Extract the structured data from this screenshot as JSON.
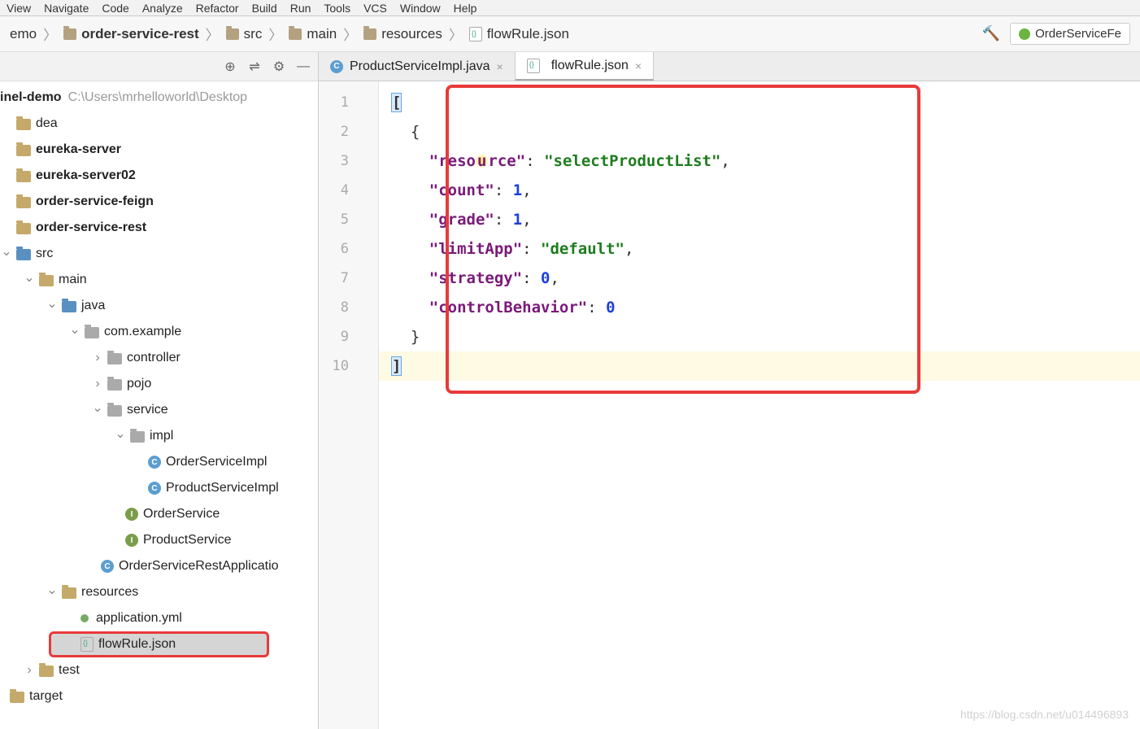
{
  "menu": {
    "items": [
      "View",
      "Navigate",
      "Code",
      "Analyze",
      "Refactor",
      "Build",
      "Run",
      "Tools",
      "VCS",
      "Window",
      "Help"
    ]
  },
  "breadcrumb": {
    "items": [
      {
        "label": "emo"
      },
      {
        "label": "order-service-rest",
        "bold": true
      },
      {
        "label": "src"
      },
      {
        "label": "main"
      },
      {
        "label": "resources"
      },
      {
        "label": "flowRule.json",
        "icon": "json"
      }
    ],
    "runConfig": "OrderServiceFe"
  },
  "projectTree": {
    "root": {
      "label": "inel-demo",
      "path": "C:\\Users\\mrhelloworld\\Desktop"
    },
    "nodes": [
      {
        "label": "dea",
        "icon": "folder",
        "indent": 0
      },
      {
        "label": "eureka-server",
        "icon": "folder",
        "bold": true,
        "indent": 0
      },
      {
        "label": "eureka-server02",
        "icon": "folder",
        "bold": true,
        "indent": 0
      },
      {
        "label": "order-service-feign",
        "icon": "folder",
        "bold": true,
        "indent": 0
      },
      {
        "label": "order-service-rest",
        "icon": "folder",
        "bold": true,
        "indent": 0
      },
      {
        "label": "src",
        "icon": "folder-blue",
        "indent": 1,
        "chevron": "down"
      },
      {
        "label": "main",
        "icon": "folder",
        "indent": 2,
        "chevron": "down"
      },
      {
        "label": "java",
        "icon": "folder-blue",
        "indent": 3,
        "chevron": "down"
      },
      {
        "label": "com.example",
        "icon": "folder-gray",
        "indent": 4,
        "chevron": "down"
      },
      {
        "label": "controller",
        "icon": "folder-gray",
        "indent": 5,
        "chevron": "right"
      },
      {
        "label": "pojo",
        "icon": "folder-gray",
        "indent": 5,
        "chevron": "right"
      },
      {
        "label": "service",
        "icon": "folder-gray",
        "indent": 5,
        "chevron": "down"
      },
      {
        "label": "impl",
        "icon": "folder-gray",
        "indent": 6,
        "chevron": "down"
      },
      {
        "label": "OrderServiceImpl",
        "icon": "class",
        "indent": 7
      },
      {
        "label": "ProductServiceImpl",
        "icon": "class",
        "indent": 7
      },
      {
        "label": "OrderService",
        "icon": "interface",
        "indent": 6
      },
      {
        "label": "ProductService",
        "icon": "interface",
        "indent": 6
      },
      {
        "label": "OrderServiceRestApplicatio",
        "icon": "class-run",
        "indent": 5
      },
      {
        "label": "resources",
        "icon": "folder",
        "indent": 3,
        "chevron": "down"
      },
      {
        "label": "application.yml",
        "icon": "yml",
        "indent": 4
      },
      {
        "label": "flowRule.json",
        "icon": "json",
        "indent": 4,
        "selected": true,
        "redbox": true
      },
      {
        "label": "test",
        "icon": "folder",
        "indent": 2,
        "chevron": "right"
      },
      {
        "label": "target",
        "icon": "folder",
        "indent": 1
      }
    ]
  },
  "editor": {
    "tabs": [
      {
        "label": "ProductServiceImpl.java",
        "icon": "class",
        "active": false
      },
      {
        "label": "flowRule.json",
        "icon": "json",
        "active": true
      }
    ],
    "lineNumbers": [
      "1",
      "2",
      "3",
      "4",
      "5",
      "6",
      "7",
      "8",
      "9",
      "10"
    ],
    "code": {
      "resourceKey": "\"resource\"",
      "resourceVal": "\"selectProductList\"",
      "countKey": "\"count\"",
      "countVal": "1",
      "gradeKey": "\"grade\"",
      "gradeVal": "1",
      "limitAppKey": "\"limitApp\"",
      "limitAppVal": "\"default\"",
      "strategyKey": "\"strategy\"",
      "strategyVal": "0",
      "controlBehaviorKey": "\"controlBehavior\"",
      "controlBehaviorVal": "0"
    }
  },
  "watermark": "https://blog.csdn.net/u014496893"
}
